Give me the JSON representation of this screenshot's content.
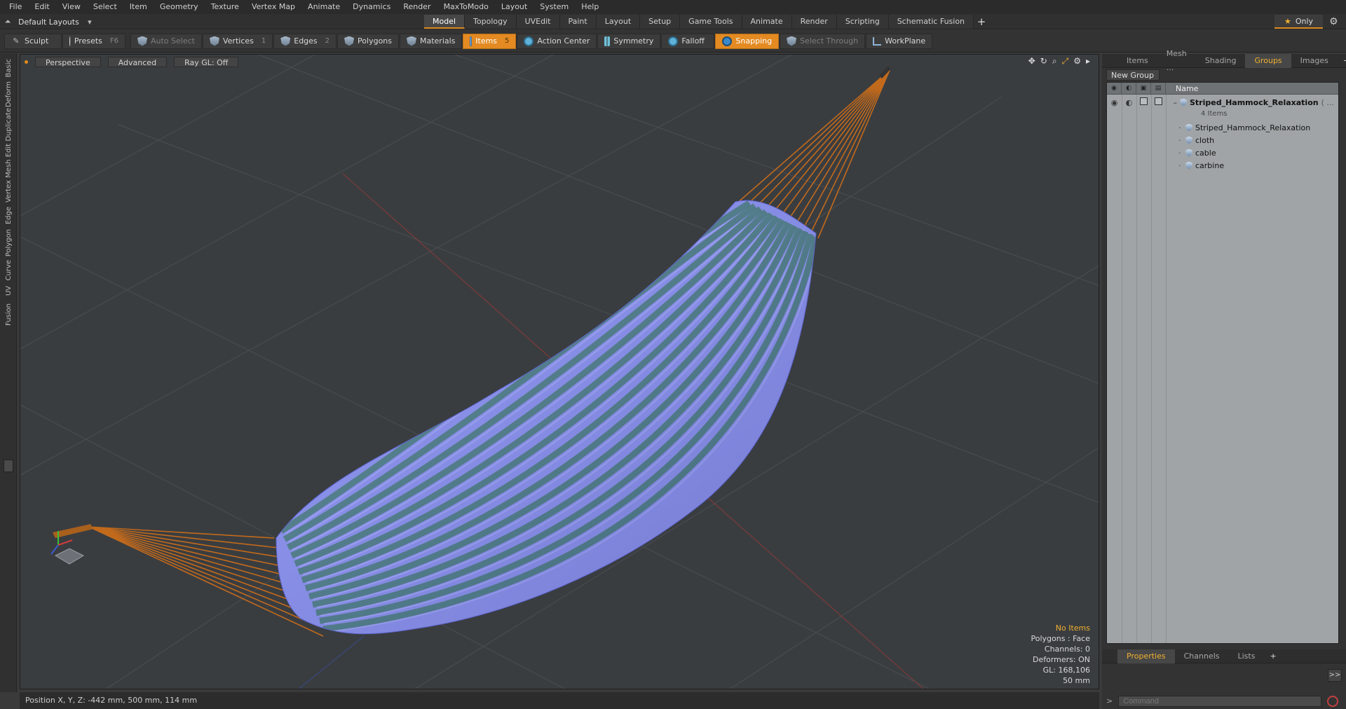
{
  "menubar": [
    "File",
    "Edit",
    "View",
    "Select",
    "Item",
    "Geometry",
    "Texture",
    "Vertex Map",
    "Animate",
    "Dynamics",
    "Render",
    "MaxToModo",
    "Layout",
    "System",
    "Help"
  ],
  "layout": {
    "name": "Default Layouts"
  },
  "tabs": [
    "Model",
    "Topology",
    "UVEdit",
    "Paint",
    "Layout",
    "Setup",
    "Game Tools",
    "Animate",
    "Render",
    "Scripting",
    "Schematic Fusion"
  ],
  "active_tab": "Model",
  "only_label": "Only",
  "toolbar": {
    "sculpt": "Sculpt",
    "presets": "Presets",
    "presets_key": "F6",
    "auto_select": "Auto Select",
    "vertices": "Vertices",
    "vertices_key": "1",
    "edges": "Edges",
    "edges_key": "2",
    "polygons": "Polygons",
    "materials": "Materials",
    "items": "Items",
    "items_key": "5",
    "action_center": "Action Center",
    "symmetry": "Symmetry",
    "falloff": "Falloff",
    "snapping": "Snapping",
    "select_through": "Select Through",
    "workplane": "WorkPlane"
  },
  "left_tabs": [
    "Basic",
    "Deform",
    "Duplicate",
    "Mesh Edit",
    "Vertex",
    "Edge",
    "Polygon",
    "Curve",
    "UV",
    "Fusion"
  ],
  "viewport": {
    "view_label": "Perspective",
    "shading_label": "Advanced",
    "raygl_label": "Ray GL: Off",
    "info": {
      "no_items": "No Items",
      "polygons": "Polygons : Face",
      "channels": "Channels: 0",
      "deformers": "Deformers: ON",
      "gl": "GL: 168,106",
      "scale": "50 mm"
    }
  },
  "statusbar": {
    "position": "Position X, Y, Z:   -442 mm, 500 mm, 114 mm"
  },
  "rightpanel": {
    "tabs": [
      "Items",
      "Mesh ...",
      "Shading",
      "Groups",
      "Images"
    ],
    "active_tab": "Groups",
    "new_group": "New Group",
    "name_header": "Name",
    "group": {
      "name": "Striped_Hammock_Relaxation",
      "suffix": "( ...",
      "count": "4 Items"
    },
    "children": [
      "Striped_Hammock_Relaxation",
      "cloth",
      "cable",
      "carbine"
    ],
    "bottom_tabs": [
      "Properties",
      "Channels",
      "Lists"
    ],
    "bottom_active": "Properties",
    "command_placeholder": "Command",
    "expand_label": ">>"
  },
  "colors": {
    "accent": "#e08a1e",
    "fabric_blue": "#8c93ee",
    "fabric_green": "#3f7a6a",
    "rope": "#c26a1c"
  }
}
